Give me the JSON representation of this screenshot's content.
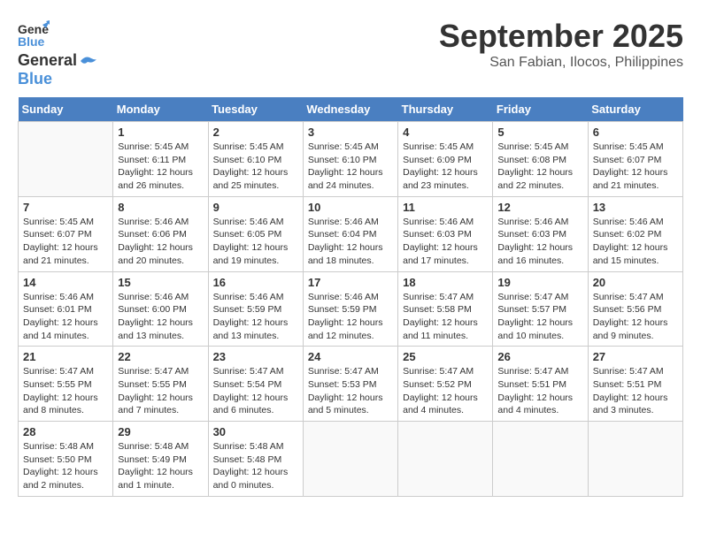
{
  "logo": {
    "line1": "General",
    "line2": "Blue"
  },
  "title": "September 2025",
  "subtitle": "San Fabian, Ilocos, Philippines",
  "days_of_week": [
    "Sunday",
    "Monday",
    "Tuesday",
    "Wednesday",
    "Thursday",
    "Friday",
    "Saturday"
  ],
  "weeks": [
    [
      {
        "day": "",
        "info": ""
      },
      {
        "day": "1",
        "info": "Sunrise: 5:45 AM\nSunset: 6:11 PM\nDaylight: 12 hours\nand 26 minutes."
      },
      {
        "day": "2",
        "info": "Sunrise: 5:45 AM\nSunset: 6:10 PM\nDaylight: 12 hours\nand 25 minutes."
      },
      {
        "day": "3",
        "info": "Sunrise: 5:45 AM\nSunset: 6:10 PM\nDaylight: 12 hours\nand 24 minutes."
      },
      {
        "day": "4",
        "info": "Sunrise: 5:45 AM\nSunset: 6:09 PM\nDaylight: 12 hours\nand 23 minutes."
      },
      {
        "day": "5",
        "info": "Sunrise: 5:45 AM\nSunset: 6:08 PM\nDaylight: 12 hours\nand 22 minutes."
      },
      {
        "day": "6",
        "info": "Sunrise: 5:45 AM\nSunset: 6:07 PM\nDaylight: 12 hours\nand 21 minutes."
      }
    ],
    [
      {
        "day": "7",
        "info": "Sunrise: 5:45 AM\nSunset: 6:07 PM\nDaylight: 12 hours\nand 21 minutes."
      },
      {
        "day": "8",
        "info": "Sunrise: 5:46 AM\nSunset: 6:06 PM\nDaylight: 12 hours\nand 20 minutes."
      },
      {
        "day": "9",
        "info": "Sunrise: 5:46 AM\nSunset: 6:05 PM\nDaylight: 12 hours\nand 19 minutes."
      },
      {
        "day": "10",
        "info": "Sunrise: 5:46 AM\nSunset: 6:04 PM\nDaylight: 12 hours\nand 18 minutes."
      },
      {
        "day": "11",
        "info": "Sunrise: 5:46 AM\nSunset: 6:03 PM\nDaylight: 12 hours\nand 17 minutes."
      },
      {
        "day": "12",
        "info": "Sunrise: 5:46 AM\nSunset: 6:03 PM\nDaylight: 12 hours\nand 16 minutes."
      },
      {
        "day": "13",
        "info": "Sunrise: 5:46 AM\nSunset: 6:02 PM\nDaylight: 12 hours\nand 15 minutes."
      }
    ],
    [
      {
        "day": "14",
        "info": "Sunrise: 5:46 AM\nSunset: 6:01 PM\nDaylight: 12 hours\nand 14 minutes."
      },
      {
        "day": "15",
        "info": "Sunrise: 5:46 AM\nSunset: 6:00 PM\nDaylight: 12 hours\nand 13 minutes."
      },
      {
        "day": "16",
        "info": "Sunrise: 5:46 AM\nSunset: 5:59 PM\nDaylight: 12 hours\nand 13 minutes."
      },
      {
        "day": "17",
        "info": "Sunrise: 5:46 AM\nSunset: 5:59 PM\nDaylight: 12 hours\nand 12 minutes."
      },
      {
        "day": "18",
        "info": "Sunrise: 5:47 AM\nSunset: 5:58 PM\nDaylight: 12 hours\nand 11 minutes."
      },
      {
        "day": "19",
        "info": "Sunrise: 5:47 AM\nSunset: 5:57 PM\nDaylight: 12 hours\nand 10 minutes."
      },
      {
        "day": "20",
        "info": "Sunrise: 5:47 AM\nSunset: 5:56 PM\nDaylight: 12 hours\nand 9 minutes."
      }
    ],
    [
      {
        "day": "21",
        "info": "Sunrise: 5:47 AM\nSunset: 5:55 PM\nDaylight: 12 hours\nand 8 minutes."
      },
      {
        "day": "22",
        "info": "Sunrise: 5:47 AM\nSunset: 5:55 PM\nDaylight: 12 hours\nand 7 minutes."
      },
      {
        "day": "23",
        "info": "Sunrise: 5:47 AM\nSunset: 5:54 PM\nDaylight: 12 hours\nand 6 minutes."
      },
      {
        "day": "24",
        "info": "Sunrise: 5:47 AM\nSunset: 5:53 PM\nDaylight: 12 hours\nand 5 minutes."
      },
      {
        "day": "25",
        "info": "Sunrise: 5:47 AM\nSunset: 5:52 PM\nDaylight: 12 hours\nand 4 minutes."
      },
      {
        "day": "26",
        "info": "Sunrise: 5:47 AM\nSunset: 5:51 PM\nDaylight: 12 hours\nand 4 minutes."
      },
      {
        "day": "27",
        "info": "Sunrise: 5:47 AM\nSunset: 5:51 PM\nDaylight: 12 hours\nand 3 minutes."
      }
    ],
    [
      {
        "day": "28",
        "info": "Sunrise: 5:48 AM\nSunset: 5:50 PM\nDaylight: 12 hours\nand 2 minutes."
      },
      {
        "day": "29",
        "info": "Sunrise: 5:48 AM\nSunset: 5:49 PM\nDaylight: 12 hours\nand 1 minute."
      },
      {
        "day": "30",
        "info": "Sunrise: 5:48 AM\nSunset: 5:48 PM\nDaylight: 12 hours\nand 0 minutes."
      },
      {
        "day": "",
        "info": ""
      },
      {
        "day": "",
        "info": ""
      },
      {
        "day": "",
        "info": ""
      },
      {
        "day": "",
        "info": ""
      }
    ]
  ]
}
